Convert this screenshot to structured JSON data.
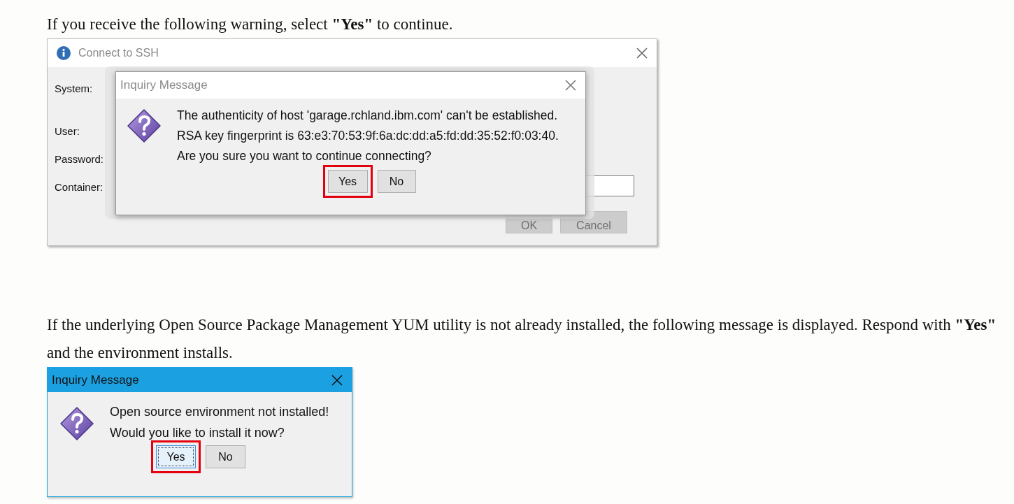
{
  "instruction_1": "If you receive the following warning, select **\"Yes\"** to continue.",
  "ssh_window": {
    "title": "Connect to SSH",
    "active": false,
    "fields": [
      {
        "label": "System:"
      },
      {
        "label": "User:"
      },
      {
        "label": "Password:"
      },
      {
        "label": "Container:"
      }
    ],
    "buttons": [
      {
        "label": "OK",
        "disabled": true
      },
      {
        "label": "Cancel",
        "disabled": true
      }
    ],
    "inquiry": {
      "title": "Inquiry Message",
      "active": false,
      "lines": [
        "The authenticity of host 'garage.rchland.ibm.com' can't be established.",
        "RSA key fingerprint is 63:e3:70:53:9f:6a:dc:dd:a5:fd:dd:35:52:f0:03:40.",
        "Are you sure you want to continue connecting?"
      ],
      "buttons": [
        {
          "label": "Yes",
          "highlighted": true,
          "focused": false
        },
        {
          "label": "No",
          "highlighted": false,
          "focused": false
        }
      ]
    }
  },
  "instruction_2": "If the underlying Open Source Package Management YUM utility is not already installed, the following message is displayed. Respond with **\"Yes\"** and the environment installs.",
  "install_dialog": {
    "title": "Inquiry Message",
    "active": true,
    "lines": [
      "Open source environment not installed!",
      "Would you like to install it now?"
    ],
    "buttons": [
      {
        "label": "Yes",
        "highlighted": true,
        "focused": true
      },
      {
        "label": "No",
        "highlighted": false,
        "focused": false
      }
    ]
  }
}
